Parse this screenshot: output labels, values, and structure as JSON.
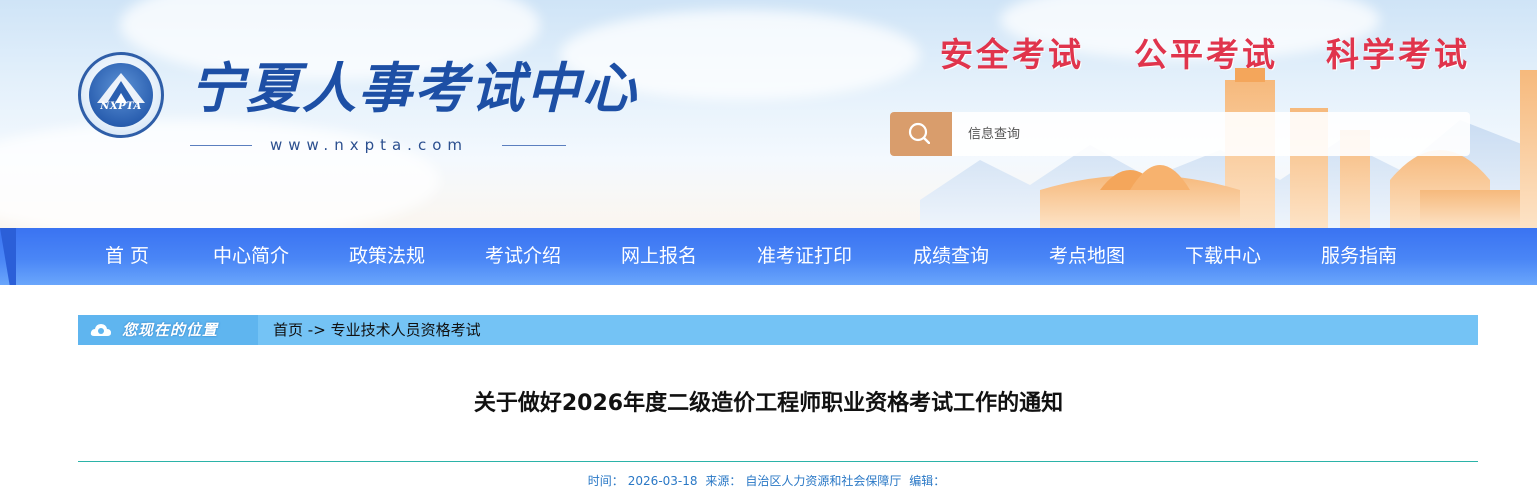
{
  "header": {
    "site_title": "宁夏人事考试中心",
    "logo_text": "NXPTA",
    "site_url": "www.nxpta.com",
    "slogans": [
      "安全考试",
      "公平考试",
      "科学考试"
    ],
    "search": {
      "placeholder": "信息查询",
      "icon": "search-icon"
    }
  },
  "nav": {
    "items": [
      {
        "label": "首 页"
      },
      {
        "label": "中心简介"
      },
      {
        "label": "政策法规"
      },
      {
        "label": "考试介绍"
      },
      {
        "label": "网上报名"
      },
      {
        "label": "准考证打印"
      },
      {
        "label": "成绩查询"
      },
      {
        "label": "考点地图"
      },
      {
        "label": "下载中心"
      },
      {
        "label": "服务指南"
      }
    ]
  },
  "breadcrumb": {
    "label": "您现在的位置",
    "home": "首页",
    "separator": "->",
    "current": "专业技术人员资格考试"
  },
  "article": {
    "title": "关于做好2026年度二级造价工程师职业资格考试工作的通知",
    "meta": {
      "time_label": "时间：",
      "time_value": "2026-03-18",
      "source_label": "来源：",
      "source_value": "自治区人力资源和社会保障厅",
      "editor_label": "编辑：",
      "editor_value": ""
    }
  },
  "colors": {
    "nav_blue": "#4a86f6",
    "slogan_red": "#e0344c",
    "title_blue": "#1d4fa5",
    "search_btn": "#d99d6c",
    "breadcrumb_bg": "#74c3f5",
    "divider": "#2bb3a8",
    "meta_text": "#2a78c6"
  }
}
